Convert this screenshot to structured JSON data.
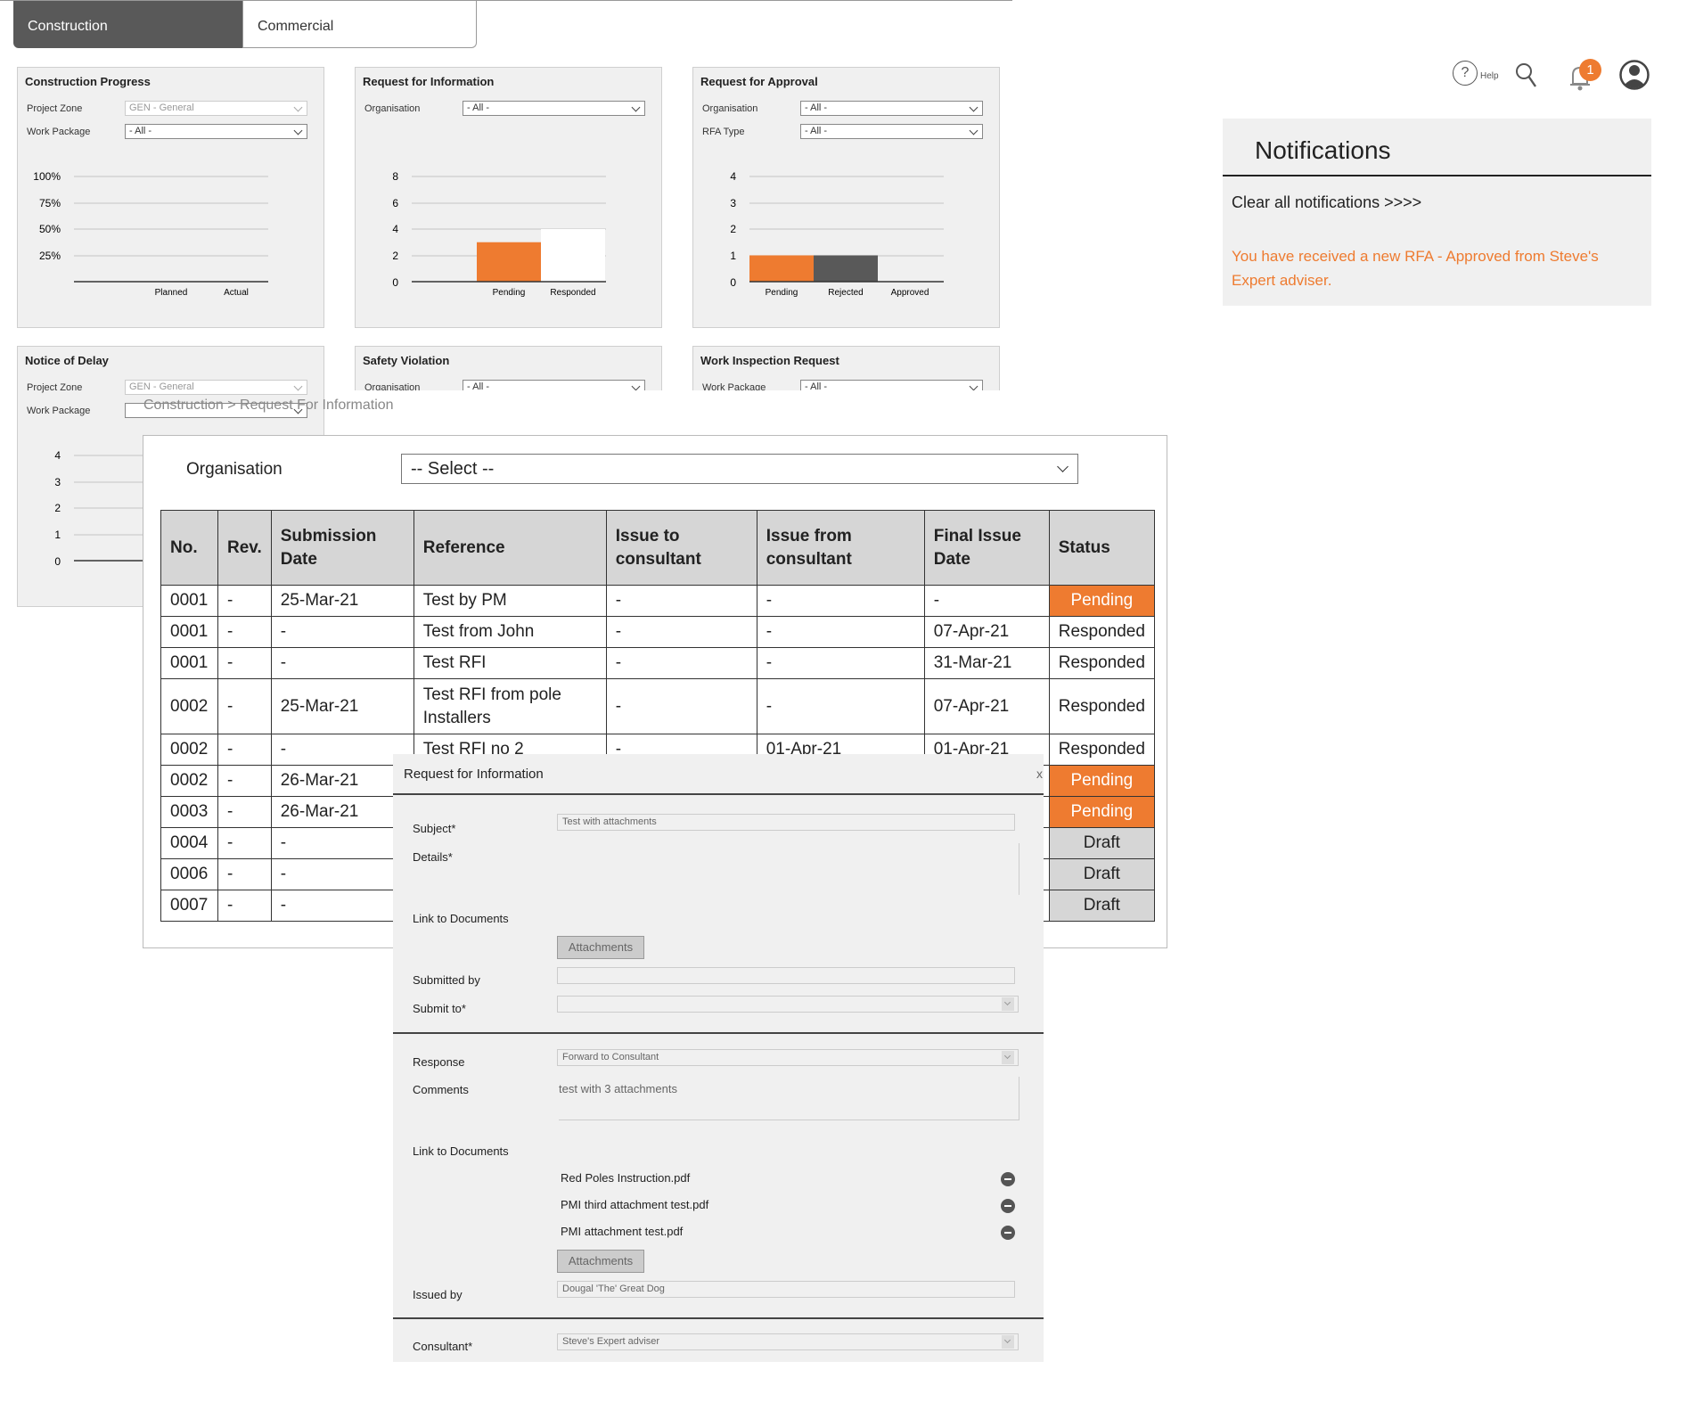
{
  "tabs": {
    "active": "Construction",
    "inactive": "Commercial"
  },
  "cards": {
    "construction_progress": {
      "title": "Construction Progress",
      "f1_label": "Project Zone",
      "f1_value": "GEN - General",
      "f2_label": "Work Package",
      "f2_value": "- All -",
      "yticks": [
        "100%",
        "75%",
        "50%",
        "25%"
      ],
      "categories": [
        "Planned",
        "Actual"
      ]
    },
    "rfi": {
      "title": "Request for Information",
      "f1_label": "Organisation",
      "f1_value": "- All -",
      "yticks": [
        "8",
        "6",
        "4",
        "2",
        "0"
      ],
      "categories": [
        "Pending",
        "Responded"
      ]
    },
    "rfa": {
      "title": "Request for Approval",
      "f1_label": "Organisation",
      "f1_value": "- All -",
      "f2_label": "RFA Type",
      "f2_value": "- All -",
      "yticks": [
        "4",
        "3",
        "2",
        "1",
        "0"
      ],
      "categories": [
        "Pending",
        "Rejected",
        "Approved"
      ]
    },
    "notice_of_delay": {
      "title": "Notice of Delay",
      "f1_label": "Project Zone",
      "f1_value": "GEN - General",
      "f2_label": "Work Package",
      "yticks": [
        "4",
        "3",
        "2",
        "1",
        "0"
      ]
    },
    "safety_violation": {
      "title": "Safety Violation",
      "f1_label": "Organisation",
      "f1_value": "- All -"
    },
    "work_inspection": {
      "title": "Work Inspection Request",
      "f1_label": "Work Package",
      "f1_value": "- All -"
    }
  },
  "chart_data": [
    {
      "type": "bar",
      "title": "Construction Progress",
      "categories": [
        "Planned",
        "Actual"
      ],
      "values": [
        0,
        0
      ],
      "ylim": [
        0,
        100
      ]
    },
    {
      "type": "bar",
      "title": "Request for Information",
      "categories": [
        "Pending",
        "Responded"
      ],
      "values": [
        3,
        4
      ],
      "ylim": [
        0,
        8
      ],
      "colors": [
        "#ee7b30",
        "#ffffff"
      ]
    },
    {
      "type": "bar",
      "title": "Request for Approval",
      "categories": [
        "Pending",
        "Rejected",
        "Approved"
      ],
      "values": [
        1,
        1,
        0
      ],
      "ylim": [
        0,
        4
      ],
      "colors": [
        "#ee7b30",
        "#595959",
        "#999999"
      ]
    }
  ],
  "header": {
    "help_label": "Help",
    "help_icon": "?",
    "notification_count": "1"
  },
  "notifications": {
    "title": "Notifications",
    "clear_label": "Clear all notifications >>>>",
    "message": "You have received a new RFA - Approved from Steve's Expert adviser."
  },
  "breadcrumb": "Construction > Request For Information",
  "rfi_list": {
    "org_label": "Organisation",
    "org_value": "-- Select --",
    "columns": [
      "No.",
      "Rev.",
      "Submission Date",
      "Reference",
      "Issue to consultant",
      "Issue from consultant",
      "Final Issue Date",
      "Status"
    ],
    "rows": [
      [
        "0001",
        "-",
        "25-Mar-21",
        "Test by PM",
        "-",
        "-",
        "-",
        "Pending"
      ],
      [
        "0001",
        "-",
        "-",
        "Test from John",
        "-",
        "-",
        "07-Apr-21",
        "Responded"
      ],
      [
        "0001",
        "-",
        "-",
        "Test RFI",
        "-",
        "-",
        "31-Mar-21",
        "Responded"
      ],
      [
        "0002",
        "-",
        "25-Mar-21",
        "Test RFI from pole Installers",
        "-",
        "-",
        "07-Apr-21",
        "Responded"
      ],
      [
        "0002",
        "-",
        "-",
        "Test RFI no 2",
        "-",
        "01-Apr-21",
        "01-Apr-21",
        "Responded"
      ],
      [
        "0002",
        "-",
        "26-Mar-21",
        "",
        "",
        "",
        "",
        "Pending"
      ],
      [
        "0003",
        "-",
        "26-Mar-21",
        "",
        "",
        "",
        "",
        "Pending"
      ],
      [
        "0004",
        "-",
        "-",
        "",
        "",
        "",
        "",
        "Draft"
      ],
      [
        "0006",
        "-",
        "-",
        "",
        "",
        "",
        "",
        "Draft"
      ],
      [
        "0007",
        "-",
        "-",
        "",
        "",
        "",
        "",
        "Draft"
      ]
    ]
  },
  "modal": {
    "title": "Request for Information",
    "close": "x",
    "subject_label": "Subject*",
    "subject_value": "Test with attachments",
    "details_label": "Details*",
    "link_docs_label": "Link to Documents",
    "attachments_label": "Attachments",
    "submitted_by_label": "Submitted by",
    "submit_to_label": "Submit to*",
    "response_label": "Response",
    "response_value": "Forward to Consultant",
    "comments_label": "Comments",
    "comments_value": "test with 3 attachments",
    "link_docs_label2": "Link to Documents",
    "files": [
      "Red Poles Instruction.pdf",
      "PMI third attachment test.pdf",
      "PMI attachment test.pdf"
    ],
    "attachments_label2": "Attachments",
    "issued_by_label": "Issued by",
    "issued_by_value": "Dougal 'The' Great Dog",
    "consultant_label": "Consultant*",
    "consultant_value": "Steve's Expert adviser"
  }
}
